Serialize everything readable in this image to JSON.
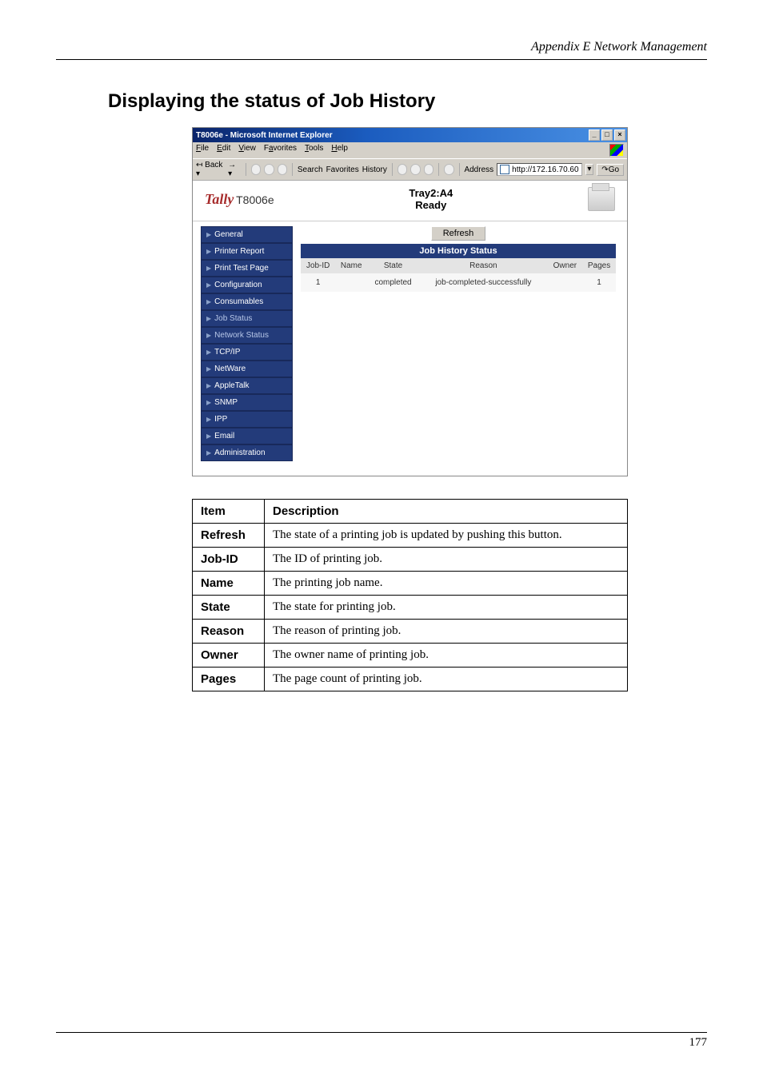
{
  "header": {
    "appendix_label": "Appendix E Network Management"
  },
  "section": {
    "title": "Displaying the status of Job History"
  },
  "browser": {
    "titlebar": "T8006e - Microsoft Internet Explorer",
    "menus": {
      "file": "File",
      "edit": "Edit",
      "view": "View",
      "favorites": "Favorites",
      "tools": "Tools",
      "help": "Help"
    },
    "toolbar": {
      "back": "Back",
      "search": "Search",
      "favorites": "Favorites",
      "history": "History",
      "address_label": "Address",
      "url": "http://172.16.70.60",
      "go": "Go"
    }
  },
  "tally": {
    "brand": "Tally",
    "model": "T8006e",
    "status_line1": "Tray2:A4",
    "status_line2": "Ready"
  },
  "sidebar": {
    "items": [
      {
        "label": "General"
      },
      {
        "label": "Printer Report"
      },
      {
        "label": "Print Test Page"
      },
      {
        "label": "Configuration"
      },
      {
        "label": "Consumables"
      },
      {
        "label": "Job Status"
      },
      {
        "label": "Network Status"
      },
      {
        "label": "TCP/IP"
      },
      {
        "label": "NetWare"
      },
      {
        "label": "AppleTalk"
      },
      {
        "label": "SNMP"
      },
      {
        "label": "IPP"
      },
      {
        "label": "Email"
      },
      {
        "label": "Administration"
      }
    ]
  },
  "main": {
    "refresh_label": "Refresh",
    "history_title": "Job History Status",
    "columns": {
      "jobid": "Job-ID",
      "name": "Name",
      "state": "State",
      "reason": "Reason",
      "owner": "Owner",
      "pages": "Pages"
    },
    "row": {
      "jobid": "1",
      "name": "",
      "state": "completed",
      "reason": "job-completed-successfully",
      "owner": "",
      "pages": "1"
    }
  },
  "table": {
    "header_item": "Item",
    "header_desc": "Description",
    "rows": [
      {
        "item": "Refresh",
        "desc": "The state of a printing job is updated by pushing this button."
      },
      {
        "item": "Job-ID",
        "desc": "The ID of printing job."
      },
      {
        "item": "Name",
        "desc": "The printing job name."
      },
      {
        "item": "State",
        "desc": "The state for printing job."
      },
      {
        "item": "Reason",
        "desc": "The reason of printing job."
      },
      {
        "item": "Owner",
        "desc": "The owner name of printing job."
      },
      {
        "item": "Pages",
        "desc": "The page count of printing job."
      }
    ]
  },
  "page_number": "177"
}
